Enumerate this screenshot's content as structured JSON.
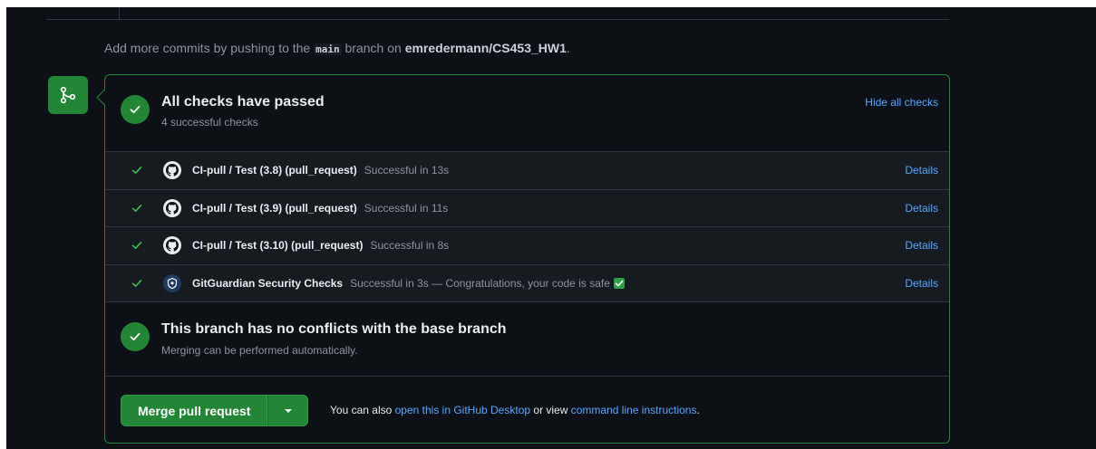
{
  "push_note": {
    "prefix": "Add more commits by pushing to the",
    "branch": "main",
    "middle": "branch on",
    "repo": "emredermann/CS453_HW1",
    "suffix": "."
  },
  "checks_section": {
    "title": "All checks have passed",
    "subtitle": "4 successful checks",
    "hide_label": "Hide all checks"
  },
  "checks": [
    {
      "name": "CI-pull / Test (3.8) (pull_request)",
      "status": "Successful in 13s",
      "details": "Details",
      "icon": "github-icon"
    },
    {
      "name": "CI-pull / Test (3.9) (pull_request)",
      "status": "Successful in 11s",
      "details": "Details",
      "icon": "github-icon"
    },
    {
      "name": "CI-pull / Test (3.10) (pull_request)",
      "status": "Successful in 8s",
      "details": "Details",
      "icon": "github-icon"
    },
    {
      "name": "GitGuardian Security Checks",
      "status": "Successful in 3s — Congratulations, your code is safe",
      "details": "Details",
      "icon": "gitguardian-icon"
    }
  ],
  "conflicts_section": {
    "title": "This branch has no conflicts with the base branch",
    "subtitle": "Merging can be performed automatically."
  },
  "merge": {
    "button_label": "Merge pull request",
    "also_prefix": "You can also",
    "desktop_link": "open this in GitHub Desktop",
    "or_view": "or view",
    "cli_link": "command line instructions",
    "suffix": "."
  },
  "colors": {
    "background": "#0d1117",
    "row_background": "#161b22",
    "success": "#238636",
    "link": "#58a6ff",
    "border": "#30363d",
    "muted_text": "#8b949e"
  }
}
